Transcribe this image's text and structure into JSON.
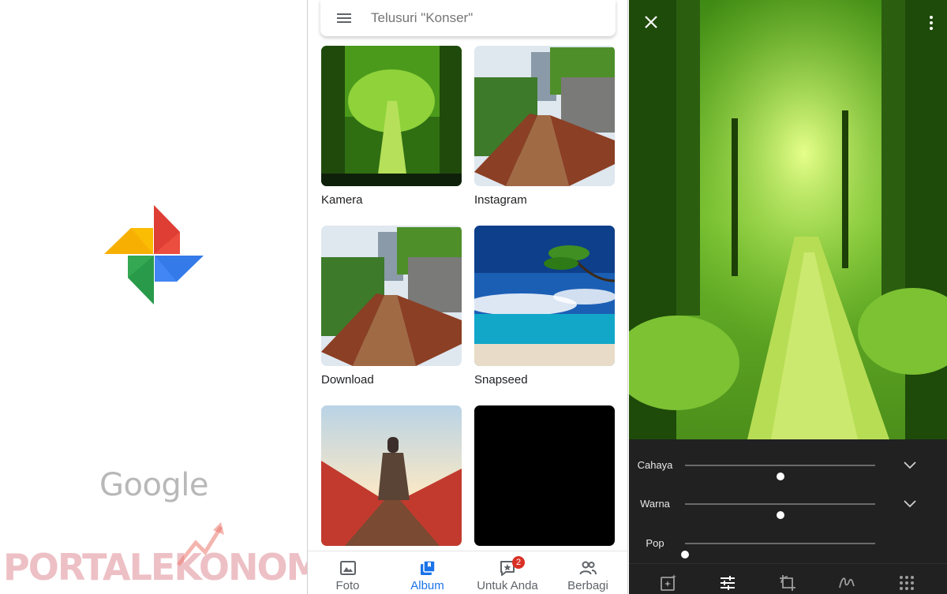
{
  "splash": {
    "brand_text": "Google",
    "watermark_text": "PORTALEKONOMI",
    "logo_colors": [
      "#ea4335",
      "#fbbc04",
      "#34a853",
      "#4285f4"
    ]
  },
  "album_screen": {
    "search": {
      "placeholder": "Telusuri \"Konser\""
    },
    "albums": [
      {
        "label": "Kamera",
        "thumb": "forest-path"
      },
      {
        "label": "Instagram",
        "thumb": "wooden-boardwalk"
      },
      {
        "label": "Download",
        "thumb": "wooden-boardwalk"
      },
      {
        "label": "Snapseed",
        "thumb": "palm-beach"
      },
      {
        "label": "",
        "thumb": "red-bridge-person"
      },
      {
        "label": "",
        "thumb": "black"
      }
    ],
    "bottom_nav": [
      {
        "label": "Foto",
        "icon": "photo-icon",
        "active": false
      },
      {
        "label": "Album",
        "icon": "album-icon",
        "active": true
      },
      {
        "label": "Untuk Anda",
        "icon": "for-you-icon",
        "active": false,
        "badge": "2"
      },
      {
        "label": "Berbagi",
        "icon": "sharing-icon",
        "active": false
      }
    ],
    "accent_color": "#1a73e8",
    "badge_color": "#d93025"
  },
  "editor": {
    "sliders": [
      {
        "label": "Cahaya",
        "value": 0.5,
        "expandable": true
      },
      {
        "label": "Warna",
        "value": 0.5,
        "expandable": true
      },
      {
        "label": "Pop",
        "value": 0.0,
        "expandable": false
      }
    ],
    "tools": [
      "auto-enhance-icon",
      "adjust-icon",
      "crop-rotate-icon",
      "markup-icon",
      "more-tools-icon"
    ],
    "active_tool": "adjust-icon",
    "background_color": "#212121"
  }
}
